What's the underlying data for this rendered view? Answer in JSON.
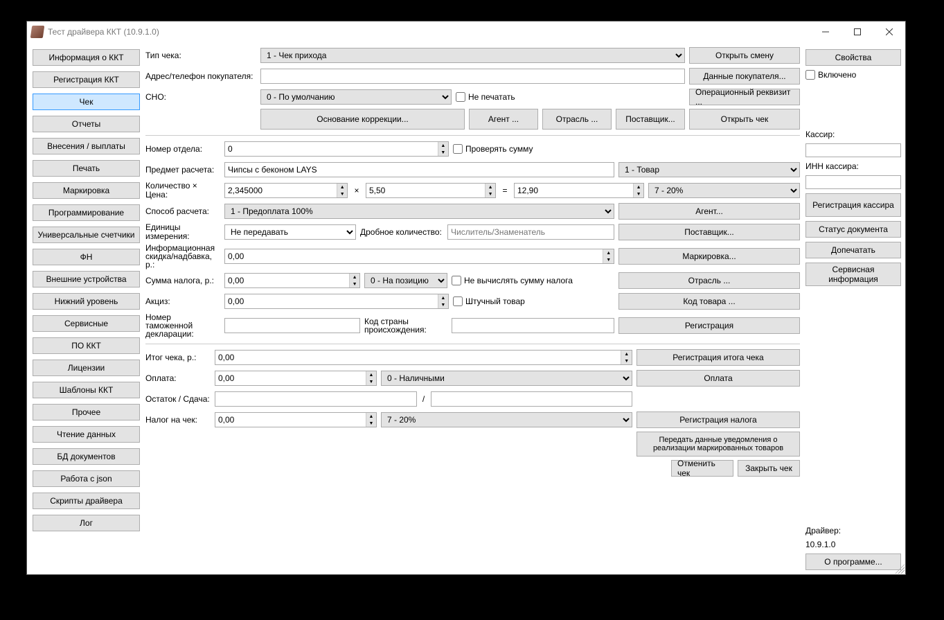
{
  "window": {
    "title": "Тест драйвера ККТ (10.9.1.0)"
  },
  "nav": {
    "items": [
      "Информация о ККТ",
      "Регистрация ККТ",
      "Чек",
      "Отчеты",
      "Внесения / выплаты",
      "Печать",
      "Маркировка",
      "Программирование",
      "Универсальные счетчики",
      "ФН",
      "Внешние устройства",
      "Нижний уровень",
      "Сервисные",
      "ПО ККТ",
      "Лицензии",
      "Шаблоны ККТ",
      "Прочее",
      "Чтение данных",
      "БД документов",
      "Работа с json",
      "Скрипты драйвера",
      "Лог"
    ],
    "active_index": 2
  },
  "labels": {
    "receipt_type": "Тип чека:",
    "buyer_addr": "Адрес/телефон покупателя:",
    "sno": "СНО:",
    "no_print": "Не печатать",
    "dept_no": "Номер отдела:",
    "check_sum": "Проверять сумму",
    "subject": "Предмет расчета:",
    "qty_price": "Количество × Цена:",
    "payment_method": "Способ расчета:",
    "units": "Единицы измерения:",
    "fractional_qty": "Дробное количество:",
    "fractional_ph": "Числитель/Знаменатель",
    "discount": "Информационная скидка/надбавка, р.:",
    "tax_sum": "Сумма налога, р.:",
    "no_calc_tax": "Не вычислять сумму налога",
    "excise": "Акциз:",
    "piece_goods": "Штучный товар",
    "customs_num": "Номер таможенной декларации:",
    "country": "Код страны происхождения:",
    "receipt_total": "Итог чека, р.:",
    "payment": "Оплата:",
    "change": "Остаток / Сдача:",
    "receipt_tax": "Налог на чек:"
  },
  "values": {
    "receipt_type": "1 - Чек прихода",
    "buyer_addr": "",
    "sno": "0 - По умолчанию",
    "dept_no": "0",
    "subject": "Чипсы с беконом LAYS",
    "subject_type": "1 - Товар",
    "qty": "2,345000",
    "price": "5,50",
    "total_pos": "12,90",
    "vat_pos": "7 - 20%",
    "payment_method": "1 - Предоплата 100%",
    "units": "Не передавать",
    "fractional": "",
    "discount": "0,00",
    "tax_sum": "0,00",
    "tax_mode": "0 - На позицию",
    "excise": "0,00",
    "customs_num": "",
    "country": "",
    "receipt_total": "0,00",
    "payment": "0,00",
    "payment_type": "0 - Наличными",
    "change_a": "",
    "change_b": "",
    "receipt_tax_sum": "0,00",
    "receipt_tax": "7 - 20%"
  },
  "buttons": {
    "open_shift": "Открыть смену",
    "buyer_data": "Данные покупателя...",
    "op_requisite": "Операционный реквизит ...",
    "correction_basis": "Основание коррекции...",
    "agent": "Агент ...",
    "industry": "Отрасль ...",
    "supplier": "Поставщик...",
    "open_receipt": "Открыть чек",
    "agent2": "Агент...",
    "supplier2": "Поставщик...",
    "marking": "Маркировка...",
    "industry2": "Отрасль ...",
    "product_code": "Код товара ...",
    "registration": "Регистрация",
    "reg_total": "Регистрация итога чека",
    "pay": "Оплата",
    "reg_tax": "Регистрация налога",
    "send_marked": "Передать данные уведомления о реализации маркированных товаров",
    "cancel_receipt": "Отменить чек",
    "close_receipt": "Закрыть чек"
  },
  "right": {
    "properties": "Свойства",
    "enabled": "Включено",
    "cashier": "Кассир:",
    "cashier_val": "",
    "tin": "ИНН кассира:",
    "tin_val": "",
    "reg_cashier": "Регистрация кассира",
    "doc_status": "Статус документа",
    "reprint": "Допечатать",
    "service_info": "Сервисная информация",
    "driver": "Драйвер:",
    "driver_ver": "10.9.1.0",
    "about": "О программе..."
  }
}
